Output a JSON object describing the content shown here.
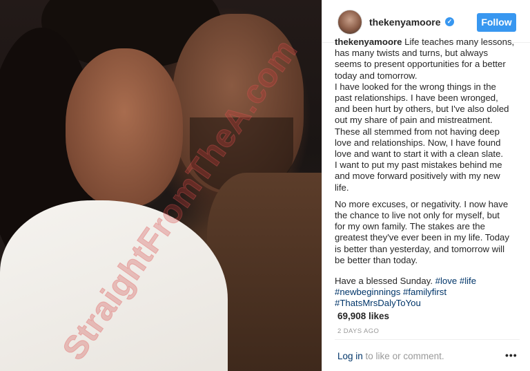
{
  "post": {
    "username": "thekenyamoore",
    "follow_label": "Follow",
    "caption": {
      "username": "thekenyamoore",
      "lines_p1": [
        " Life teaches many lessons,",
        "has many twists and turns, but always",
        "seems to present opportunities for a better",
        "today and tomorrow.",
        "I have looked for the wrong things in the",
        "past relationships. I have been wronged,",
        "and been hurt by others, but I've also doled",
        "out my share of pain and mistreatment.",
        "These all stemmed from not having deep",
        "love and relationships. Now, I have found",
        "love and want to start it with a clean slate.",
        "I want to put my past mistakes behind me",
        "and move forward positively with my new",
        "life."
      ],
      "lines_p2": [
        "No more excuses, or negativity. I now have",
        "the chance to live not only for myself, but",
        "for my own family. The stakes are the",
        "greatest they've ever been in my life. Today",
        "is better than yesterday, and tomorrow will",
        "be better than today."
      ],
      "closing": "Have a blessed Sunday. ",
      "hashtags": [
        "#love",
        "#life",
        "#newbeginnings",
        "#familyfirst",
        "#ThatsMrsDalyToYou"
      ]
    },
    "likes": "69,908 likes",
    "timestamp": "2 DAYS AGO",
    "comment_prompt": {
      "login_label": "Log in",
      "rest": " to like or comment."
    },
    "watermark": "StraightFromTheA.com"
  },
  "icons": {
    "verified": "verified-badge-icon",
    "more": "more-options-icon"
  },
  "colors": {
    "follow_button": "#3897f0",
    "link": "#003569",
    "text": "#262626",
    "muted": "#999999"
  }
}
